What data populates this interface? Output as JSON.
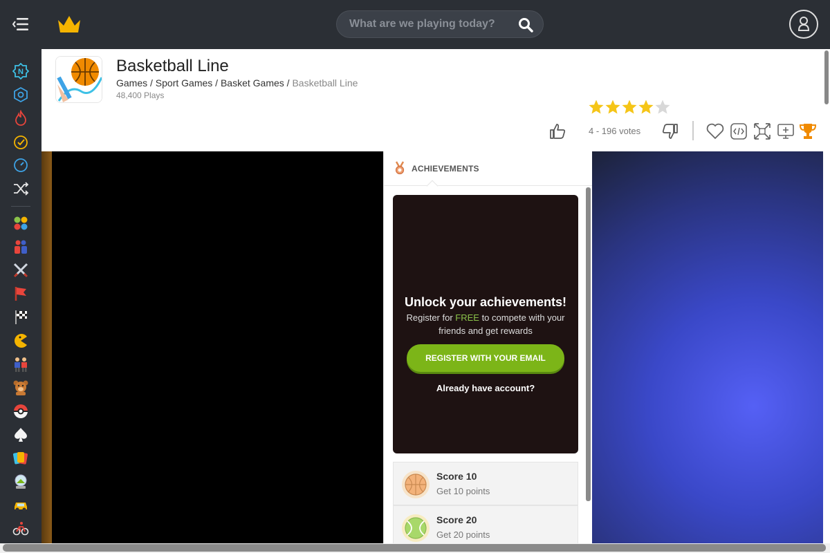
{
  "search": {
    "placeholder": "What are we playing today?"
  },
  "game": {
    "title": "Basketball Line",
    "breadcrumb": [
      "Games",
      "Sport Games",
      "Basket Games",
      "Basketball Line"
    ],
    "plays": "48,400 Plays",
    "rating": 4,
    "rating_max": 5,
    "votes": "4 - 196 votes"
  },
  "colors": {
    "accent_green": "#7cb518",
    "star": "#f5c518",
    "trophy": "#f08a00",
    "topbar": "#2b2f35"
  },
  "sidebar": {
    "icons": [
      "new-icon",
      "hexagon-icon",
      "fire-icon",
      "check-clock-icon",
      "timer-icon",
      "shuffle-icon",
      "dots-icon",
      "wrestling-icon",
      "swords-icon",
      "flag-icon",
      "checkered-flag-icon",
      "pacman-icon",
      "people-icon",
      "teddy-bear-icon",
      "pokeball-icon",
      "spade-icon",
      "cards-icon",
      "snowglobe-icon",
      "car-icon",
      "bicycle-icon"
    ]
  },
  "actions": [
    "favorite-icon",
    "embed-icon",
    "fullscreen-icon",
    "add-screen-icon",
    "trophy-icon"
  ],
  "achievements": {
    "title": "ACHIEVEMENTS",
    "unlock_title": "Unlock your achievements!",
    "unlock_desc_pre": "Register for ",
    "unlock_desc_free": "FREE",
    "unlock_desc_post": " to compete with your friends and get rewards",
    "register_label": "REGISTER WITH YOUR EMAIL",
    "already_label": "Already have account?",
    "items": [
      {
        "name": "Score 10",
        "desc": "Get 10 points",
        "ball": "basketball"
      },
      {
        "name": "Score 20",
        "desc": "Get 20 points",
        "ball": "tennis"
      }
    ]
  }
}
